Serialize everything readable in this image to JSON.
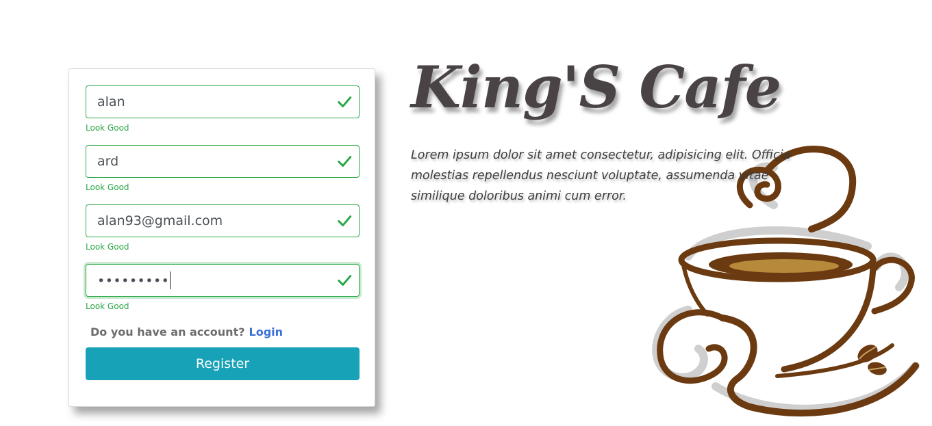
{
  "form": {
    "fields": [
      {
        "value": "alan",
        "feedback": "Look Good"
      },
      {
        "value": "ard",
        "feedback": "Look Good"
      },
      {
        "value": "alan93@gmail.com",
        "feedback": "Look Good"
      },
      {
        "value": "•••••••••",
        "feedback": "Look Good"
      }
    ],
    "account_prompt": "Do you have an account?",
    "login_label": "Login",
    "register_label": "Register"
  },
  "brand": {
    "title": "King'S Cafe",
    "description": "Lorem ipsum dolor sit amet consectetur, adipisicing elit. Officia molestias repellendus nesciunt voluptate, assumenda vitae similique doloribus animi cum error."
  },
  "colors": {
    "valid": "#28a745",
    "button": "#17a2b8",
    "link": "#3b6fd6",
    "title": "#4a4345",
    "coffee": "#6b3a10"
  },
  "icons": {
    "validation": "check-icon",
    "illustration": "coffee-cup-icon"
  }
}
